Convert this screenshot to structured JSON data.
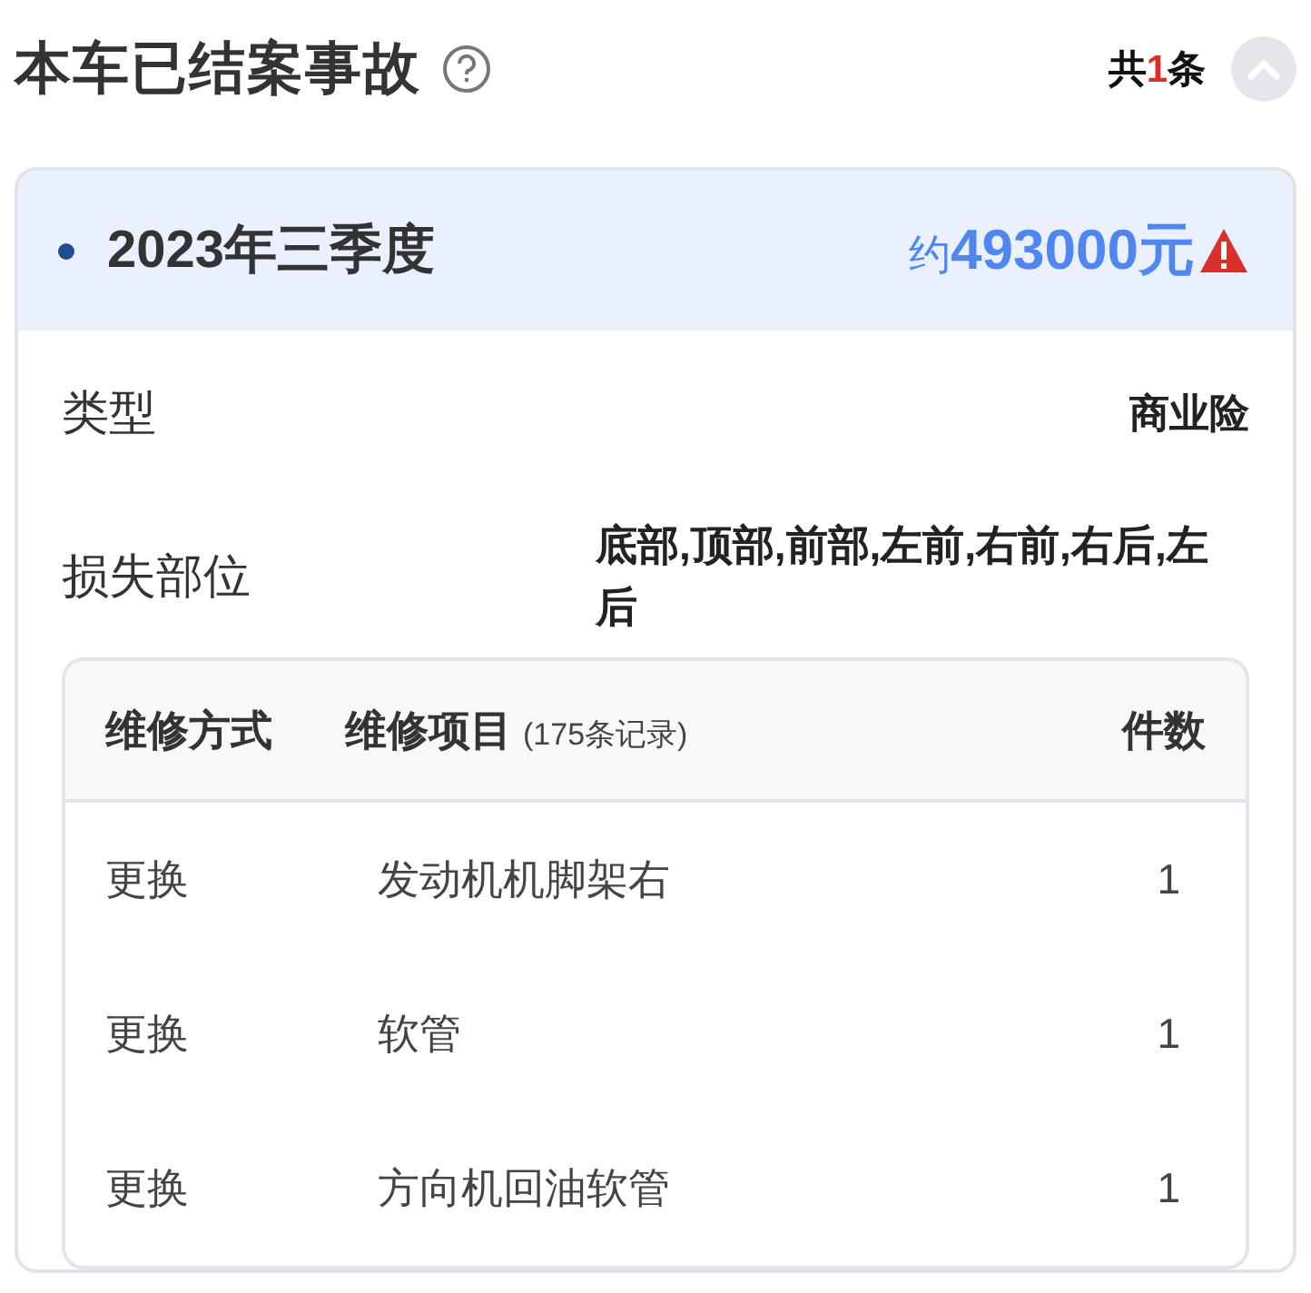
{
  "section": {
    "title": "本车已结案事故",
    "count_prefix": "共",
    "count": "1",
    "count_suffix": "条",
    "expanded": true
  },
  "accident": {
    "period": "2023年三季度",
    "amount_prefix": "约",
    "amount": "493000元",
    "warning": true,
    "details": [
      {
        "label": "类型",
        "value": "商业险"
      },
      {
        "label": "损失部位",
        "value": "底部,顶部,前部,左前,右前,右后,左后"
      }
    ],
    "table": {
      "columns": [
        {
          "label": "维修方式"
        },
        {
          "label": "维修项目",
          "note": "(175条记录)"
        },
        {
          "label": "件数"
        }
      ],
      "rows": [
        [
          "更换",
          "发动机机脚架右",
          "1"
        ],
        [
          "更换",
          "软管",
          "1"
        ],
        [
          "更换",
          "方向机回油软管",
          "1"
        ]
      ]
    }
  }
}
